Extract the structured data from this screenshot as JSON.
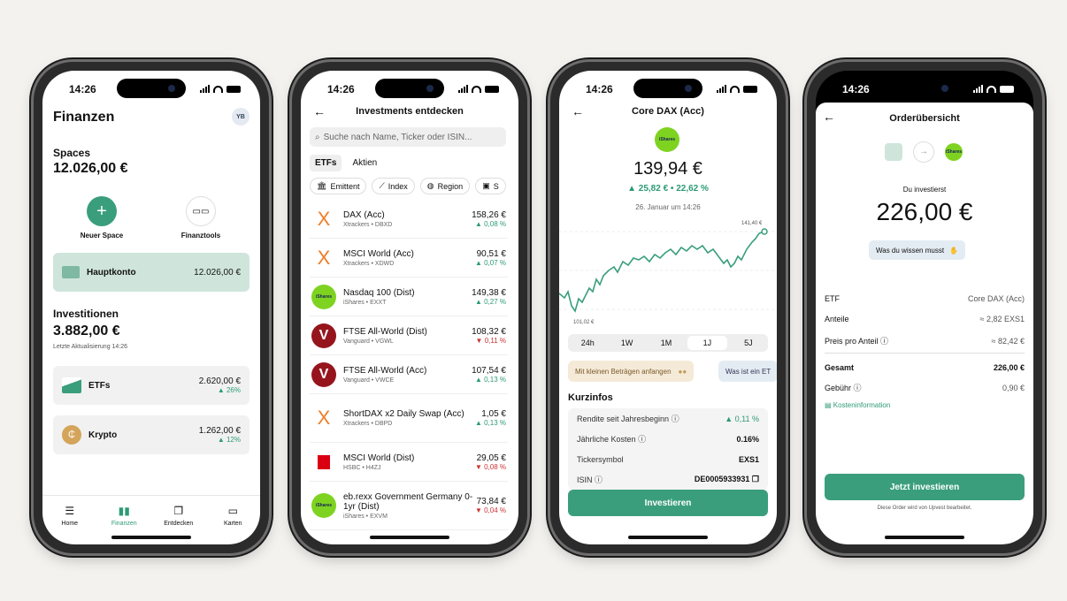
{
  "status_time": "14:26",
  "screen1": {
    "title": "Finanzen",
    "avatar": "YB",
    "spaces_label": "Spaces",
    "spaces_total": "12.026,00 €",
    "new_space": "Neuer Space",
    "finance_tools": "Finanztools",
    "main_account": {
      "name": "Hauptkonto",
      "amount": "12.026,00 €"
    },
    "investments_label": "Investitionen",
    "investments_total": "3.882,00 €",
    "last_update": "Letzte Aktualisierung 14:26",
    "holdings": [
      {
        "name": "ETFs",
        "amount": "2.620,00 €",
        "change": "▲ 26%"
      },
      {
        "name": "Krypto",
        "amount": "1.262,00 €",
        "change": "▲ 12%"
      }
    ],
    "tabs": [
      {
        "label": "Home",
        "icon": "home-icon"
      },
      {
        "label": "Finanzen",
        "icon": "bar-chart-icon"
      },
      {
        "label": "Entdecken",
        "icon": "cards-icon"
      },
      {
        "label": "Karten",
        "icon": "card-icon"
      }
    ]
  },
  "screen2": {
    "title": "Investments entdecken",
    "search_placeholder": "Suche nach Name, Ticker oder ISIN...",
    "segments": [
      "ETFs",
      "Aktien"
    ],
    "filters": [
      "Emittent",
      "Index",
      "Region",
      "S"
    ],
    "items": [
      {
        "name": "DAX (Acc)",
        "sub": "Xtrackers • DBXD",
        "price": "158,26 €",
        "change": "▲ 0,08 %",
        "dir": "up",
        "logo": "X",
        "logo_color": "#f07d25"
      },
      {
        "name": "MSCI World (Acc)",
        "sub": "Xtrackers • XDWD",
        "price": "90,51 €",
        "change": "▲ 0,07 %",
        "dir": "up",
        "logo": "X",
        "logo_color": "#f07d25"
      },
      {
        "name": "Nasdaq 100 (Dist)",
        "sub": "iShares • EXXT",
        "price": "149,38 €",
        "change": "▲ 0,27 %",
        "dir": "up",
        "logo": "iShares",
        "logo_color": "#7ed321"
      },
      {
        "name": "FTSE All-World (Dist)",
        "sub": "Vanguard • VGWL",
        "price": "108,32 €",
        "change": "▼ 0,11 %",
        "dir": "dn",
        "logo": "V",
        "logo_color": "#96151d"
      },
      {
        "name": "FTSE All-World (Acc)",
        "sub": "Vanguard • VWCE",
        "price": "107,54 €",
        "change": "▲ 0,13 %",
        "dir": "up",
        "logo": "V",
        "logo_color": "#96151d"
      },
      {
        "name": "ShortDAX x2 Daily Swap (Acc)",
        "sub": "Xtrackers • DBPD",
        "price": "1,05 €",
        "change": "▲ 0,13 %",
        "dir": "up",
        "logo": "X",
        "logo_color": "#f07d25"
      },
      {
        "name": "MSCI World (Dist)",
        "sub": "HSBC • H4ZJ",
        "price": "29,05 €",
        "change": "▼ 0,08 %",
        "dir": "dn",
        "logo": "HSBC",
        "logo_color": "#db0011"
      },
      {
        "name": "eb.rexx Government Germany 0-1yr (Dist)",
        "sub": "iShares • EXVM",
        "price": "73,84 €",
        "change": "▼ 0,04 %",
        "dir": "dn",
        "logo": "iShares",
        "logo_color": "#7ed321"
      }
    ]
  },
  "screen3": {
    "title": "Core DAX (Acc)",
    "logo": "iShares",
    "price": "139,94 €",
    "change": "▲ 25,82 € • 22,62 %",
    "date": "26. Januar um 14:26",
    "chart_high": "141,40 €",
    "chart_low": "101,02 €",
    "ranges": [
      "24h",
      "1W",
      "1M",
      "1J",
      "5J"
    ],
    "active_range": "1J",
    "promo1": "Mit kleinen Beträgen anfangen",
    "promo2": "Was ist ein ET",
    "kurzinfos": "Kurzinfos",
    "info": [
      {
        "k": "Rendite seit Jahresbeginn",
        "v": "▲ 0,11 %"
      },
      {
        "k": "Jährliche Kosten",
        "v": "0.16%"
      },
      {
        "k": "Tickersymbol",
        "v": "EXS1"
      },
      {
        "k": "ISIN",
        "v": "DE0005933931"
      }
    ],
    "cta": "Investieren"
  },
  "screen4": {
    "title": "Orderübersicht",
    "invest_label": "Du investierst",
    "amount": "226,00 €",
    "learn": "Was du wissen musst",
    "rows": [
      {
        "k": "ETF",
        "v": "Core DAX (Acc)"
      },
      {
        "k": "Anteile",
        "v": "≈ 2,82 EXS1"
      },
      {
        "k": "Preis pro Anteil",
        "v": "≈ 82,42 €"
      }
    ],
    "total_label": "Gesamt",
    "total": "226,00 €",
    "fee_label": "Gebühr",
    "fee": "0,90 €",
    "cost_info": "Kosteninformation",
    "cta": "Jetzt investieren",
    "footnote": "Diese Order wird von Upvest bearbeitet."
  }
}
